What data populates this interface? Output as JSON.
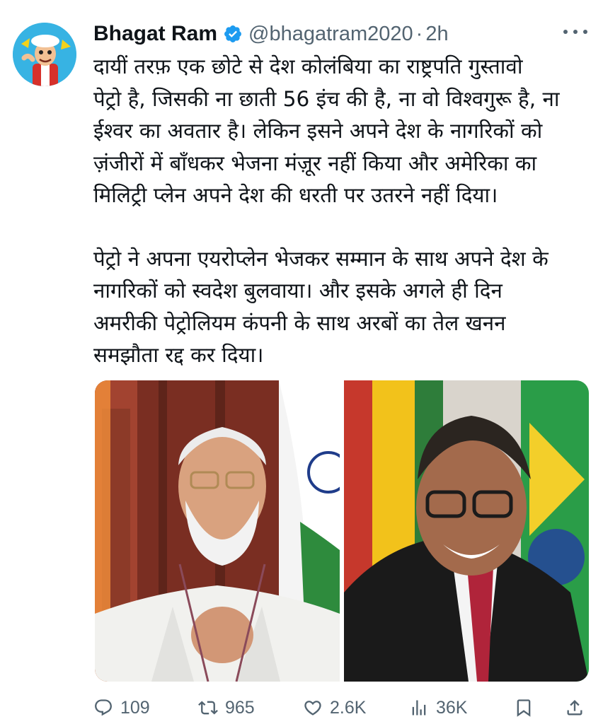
{
  "author": {
    "name": "Bhagat Ram",
    "handle": "@bhagatram2020",
    "separator": "·",
    "time": "2h",
    "verified_color": "#1d9bf0"
  },
  "tweet": {
    "paragraph_1_lines": [
      "दायीं तरफ़ एक छोटे से देश कोलंबिया का राष्ट्रपति गुस्तावो",
      "पेट्रो है, जिसकी ना छाती 56 इंच की है, ना वो विश्वगुरू है, ना",
      "ईश्वर का अवतार है। लेकिन इसने अपने देश के नागरिकों को",
      "ज़ंजीरों में बाँधकर भेजना मंज़ूर नहीं किया और अमेरिका का",
      "मिलिट्री प्लेन अपने देश की धरती पर उतरने नहीं दिया।"
    ],
    "paragraph_2_lines": [
      "पेट्रो ने अपना एयरोप्लेन भेजकर सम्मान के साथ अपने देश के",
      "नागरिकों को स्वदेश बुलवाया। और इसके अगले ही दिन",
      "अमरीकी पेट्रोलियम कंपनी के साथ अरबों का तेल खनन",
      "समझौता रद्द कर दिया।"
    ]
  },
  "actions": {
    "replies": "109",
    "retweets": "965",
    "likes": "2.6K",
    "views": "36K"
  },
  "icons": {
    "avatar": "cartoon-man-avatar",
    "verified": "verified-badge-icon",
    "more": "more-options-icon",
    "reply": "reply-icon",
    "retweet": "retweet-icon",
    "like": "heart-icon",
    "views": "views-chart-icon",
    "bookmark": "bookmark-icon",
    "share": "share-icon"
  },
  "colors": {
    "text": "#0f1419",
    "secondary": "#536471",
    "accent": "#1d9bf0"
  }
}
